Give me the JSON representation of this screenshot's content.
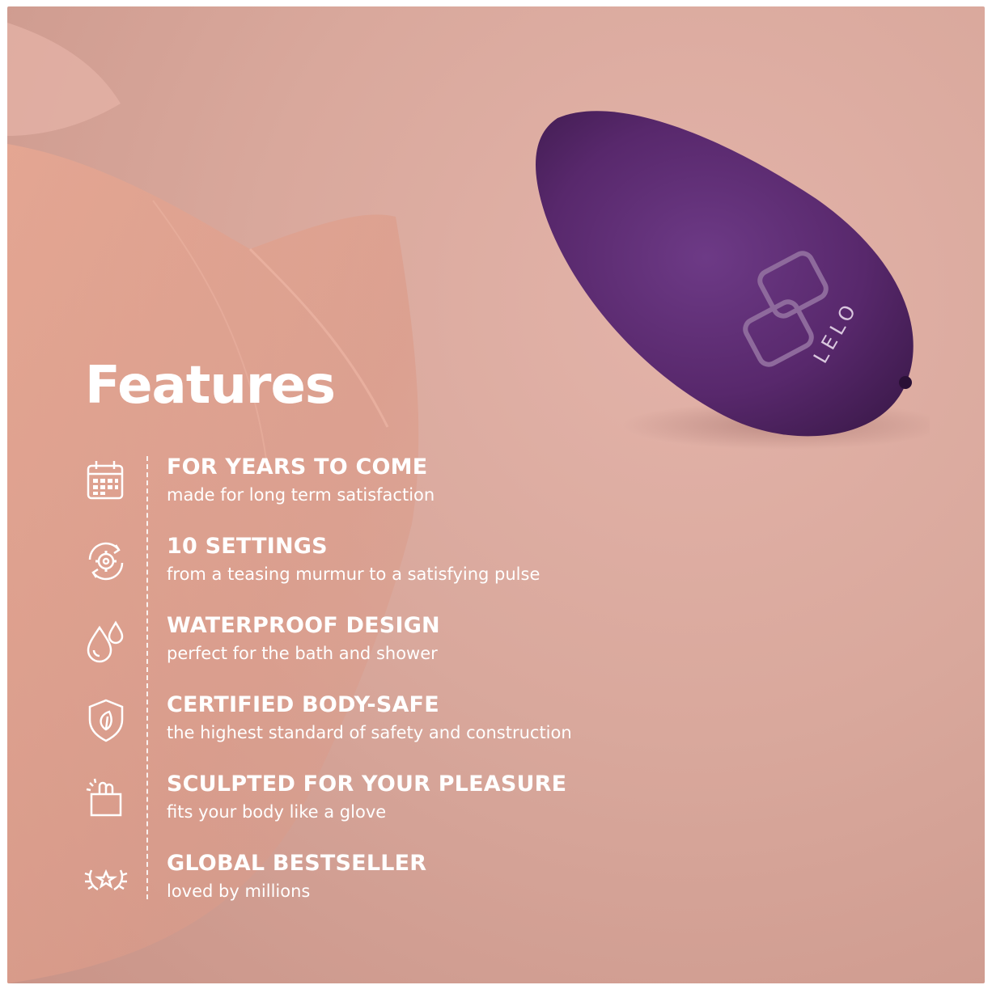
{
  "title": "Features",
  "brand_mark": "LELO",
  "colors": {
    "background": "#dcaa9e",
    "product": "#5a2a6e",
    "text": "#ffffff"
  },
  "features": [
    {
      "icon": "calendar-icon",
      "heading": "FOR YEARS TO COME",
      "description": "made for long term satisfaction"
    },
    {
      "icon": "settings-cycle-icon",
      "heading": "10 SETTINGS",
      "description": "from a teasing murmur to a satisfying pulse"
    },
    {
      "icon": "water-drops-icon",
      "heading": "WATERPROOF DESIGN",
      "description": "perfect for the bath and shower"
    },
    {
      "icon": "shield-leaf-icon",
      "heading": "CERTIFIED BODY-SAFE",
      "description": "the highest standard of safety and construction"
    },
    {
      "icon": "hand-sculpt-icon",
      "heading": "SCULPTED FOR YOUR PLEASURE",
      "description": "fits your body like a glove"
    },
    {
      "icon": "laurel-star-icon",
      "heading": "GLOBAL BESTSELLER",
      "description": "loved by millions"
    }
  ]
}
